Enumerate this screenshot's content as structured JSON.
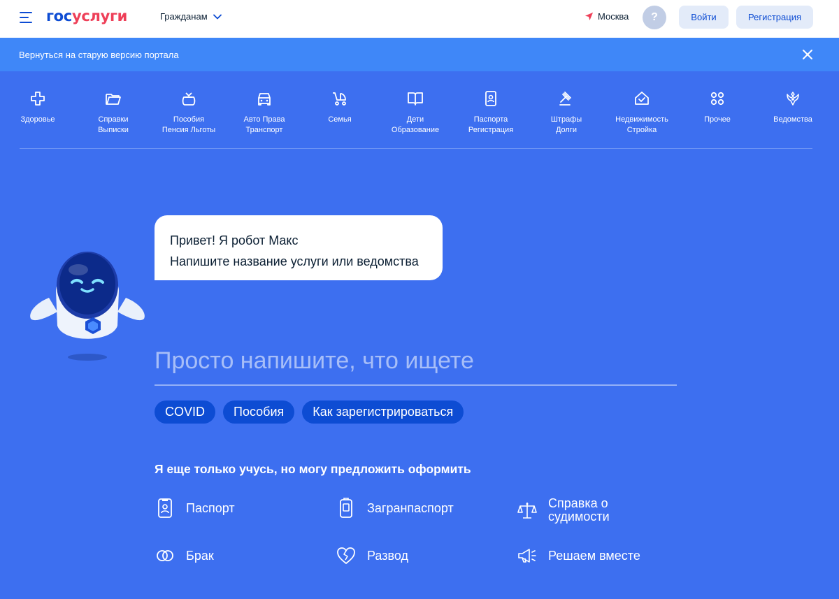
{
  "header": {
    "logo_blue": "гос",
    "logo_red": "услуги",
    "audience": "Гражданам",
    "location": "Москва",
    "help": "?",
    "login": "Войти",
    "register": "Регистрация"
  },
  "banner": {
    "text": "Вернуться на старую версию портала"
  },
  "categories": [
    {
      "label": "Здоровье",
      "icon": "health-icon"
    },
    {
      "label": "Справки\nВыписки",
      "icon": "folder-icon"
    },
    {
      "label": "Пособия\nПенсия Льготы",
      "icon": "wallet-icon"
    },
    {
      "label": "Авто Права\nТранспорт",
      "icon": "car-icon"
    },
    {
      "label": "Семья",
      "icon": "stroller-icon"
    },
    {
      "label": "Дети\nОбразование",
      "icon": "book-icon"
    },
    {
      "label": "Паспорта\nРегистрация",
      "icon": "passport-icon"
    },
    {
      "label": "Штрафы\nДолги",
      "icon": "gavel-icon"
    },
    {
      "label": "Недвижимость\nСтройка",
      "icon": "house-icon"
    },
    {
      "label": "Прочее",
      "icon": "grid-icon"
    },
    {
      "label": "Ведомства",
      "icon": "emblem-icon"
    }
  ],
  "robot": {
    "greeting": "Привет! Я робот Макс",
    "prompt": "Напишите название услуги или ведомства"
  },
  "search": {
    "placeholder": "Просто напишите, что ищете"
  },
  "chips": [
    "COVID",
    "Пособия",
    "Как зарегистрироваться"
  ],
  "suggest": {
    "title": "Я еще только учусь, но могу предложить оформить",
    "items": [
      {
        "label": "Паспорт",
        "icon": "passport-icon"
      },
      {
        "label": "Загранпаспорт",
        "icon": "foreign-passport-icon"
      },
      {
        "label": "Справка о\nсудимости",
        "icon": "scales-icon"
      },
      {
        "label": "Брак",
        "icon": "rings-icon"
      },
      {
        "label": "Развод",
        "icon": "broken-heart-icon"
      },
      {
        "label": "Решаем вместе",
        "icon": "megaphone-icon"
      }
    ]
  },
  "colors": {
    "brand_blue": "#0d4cd3",
    "brand_red": "#ee3f58",
    "background": "#3d6ff0",
    "banner": "#3f87f8"
  }
}
